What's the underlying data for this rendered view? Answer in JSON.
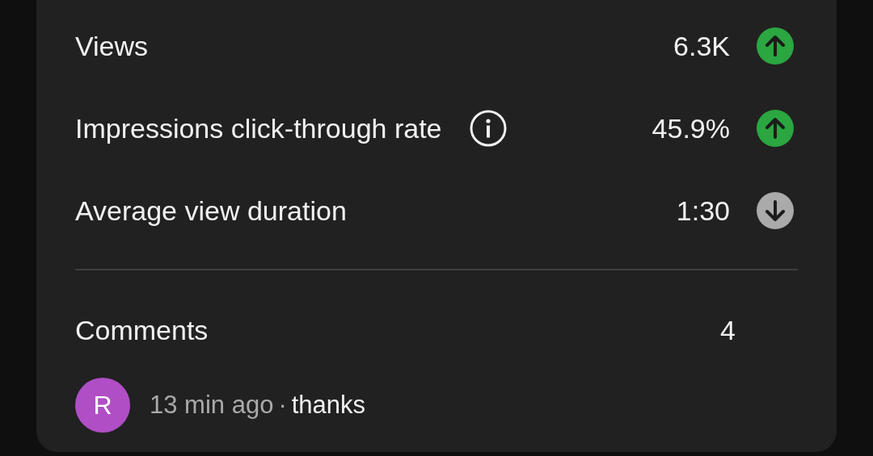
{
  "metrics": [
    {
      "label": "Views",
      "info": false,
      "value": "6.3K",
      "kind": "up"
    },
    {
      "label": "Impressions click-through rate",
      "info": true,
      "value": "45.9%",
      "kind": "up"
    },
    {
      "label": "Average view duration",
      "info": false,
      "value": "1:30",
      "kind": "down"
    }
  ],
  "comments": {
    "label": "Comments",
    "count": "4",
    "latest": {
      "avatar_letter": "R",
      "time": "13 min ago",
      "separator": "·",
      "text": "thanks"
    }
  }
}
